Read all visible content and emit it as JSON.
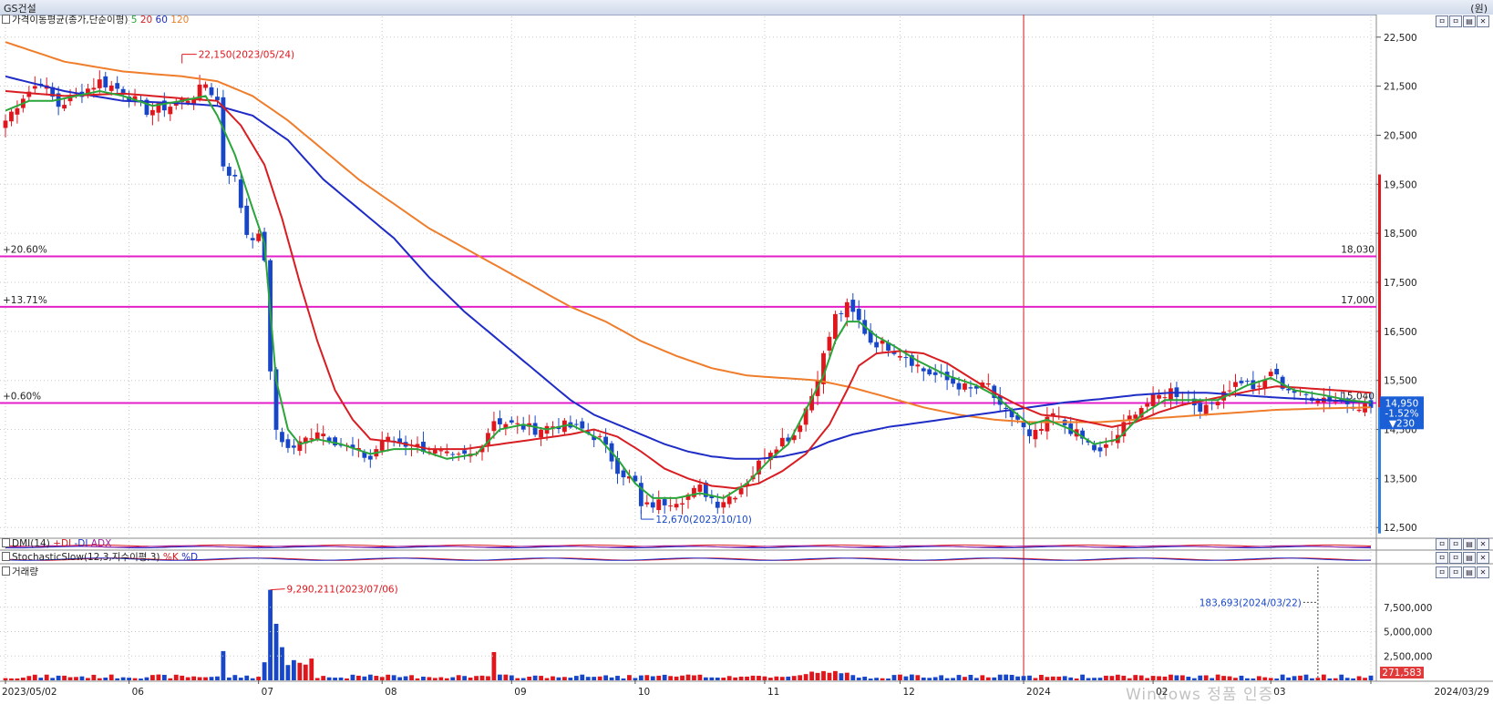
{
  "title": "GS건설",
  "unit": "(원)",
  "ma_legend": {
    "prefix": "가격이동평균(종가,단순이평)",
    "p5": "5",
    "p20": "20",
    "p60": "60",
    "p120": "120"
  },
  "colors": {
    "up": "#e0161d",
    "down": "#1747c8",
    "ma5": "#2aa53a",
    "ma20": "#d81e22",
    "ma60": "#1f2cc6",
    "ma120": "#ef7d2b",
    "hline": "#e21fc8",
    "vline": "#d11a1a"
  },
  "annotations": {
    "high": "22,150(2023/05/24)",
    "low": "12,670(2023/10/10)",
    "vol_high": "9,290,211(2023/07/06)",
    "vol_last": "183,693(2024/03/22)"
  },
  "hlines": [
    {
      "pct": "+20.60%",
      "price": "18,030",
      "value": 18030
    },
    {
      "pct": "+13.71%",
      "price": "17,000",
      "value": 17000
    },
    {
      "pct": "+0.60%",
      "price": "15,040",
      "value": 15040
    }
  ],
  "last_box": {
    "price": "14,950",
    "change_pct": "-1.52%",
    "change": "▼230"
  },
  "vol_last_box": "271,583",
  "panels": {
    "dmi": {
      "label": "DMI(14)",
      "s1": "+DI",
      "s2": "-DI",
      "s3": "ADX"
    },
    "stoch": {
      "label": "StochasticSlow(12,3,지수이평,3)",
      "s1": "%K",
      "s2": "%D"
    },
    "volume": {
      "label": "거래량"
    }
  },
  "window_controls": [
    "ㅁ",
    "ㅁ",
    "▤",
    "✕"
  ],
  "watermark": "Windows 정품 인증",
  "chart_data": {
    "type": "candlestick",
    "title": "GS건설",
    "y_range": [
      12300,
      22700
    ],
    "y_ticks": [
      12500,
      13500,
      14500,
      15500,
      16500,
      17500,
      18500,
      19500,
      20500,
      21500,
      22500
    ],
    "y_tick_labels": [
      "12,500",
      "13,500",
      "14,500",
      "15,500",
      "16,500",
      "17,500",
      "18,500",
      "19,500",
      "20,500",
      "21,500",
      "22,500"
    ],
    "x_ticks": [
      "2023/05/02",
      "06",
      "07",
      "08",
      "09",
      "10",
      "11",
      "12",
      "2024",
      "02",
      "03",
      "2024/03/29"
    ],
    "x_tick_index": [
      0,
      21,
      43,
      64,
      86,
      107,
      129,
      152,
      173,
      195,
      215,
      232
    ],
    "close_path": [
      [
        0,
        20800
      ],
      [
        3,
        21300
      ],
      [
        6,
        21600
      ],
      [
        9,
        21100
      ],
      [
        12,
        21300
      ],
      [
        16,
        21600
      ],
      [
        20,
        21400
      ],
      [
        24,
        21000
      ],
      [
        28,
        21100
      ],
      [
        32,
        21300
      ],
      [
        34,
        21550
      ],
      [
        36,
        21200
      ],
      [
        37,
        19900
      ],
      [
        39,
        19600
      ],
      [
        41,
        18500
      ],
      [
        43,
        18400
      ],
      [
        44,
        18000
      ],
      [
        45,
        15600
      ],
      [
        46,
        14500
      ],
      [
        48,
        14100
      ],
      [
        50,
        14200
      ],
      [
        53,
        14500
      ],
      [
        57,
        14200
      ],
      [
        62,
        13900
      ],
      [
        64,
        14300
      ],
      [
        68,
        14200
      ],
      [
        72,
        14100
      ],
      [
        76,
        13900
      ],
      [
        80,
        14000
      ],
      [
        83,
        14700
      ],
      [
        86,
        14600
      ],
      [
        90,
        14500
      ],
      [
        94,
        14600
      ],
      [
        98,
        14500
      ],
      [
        101,
        14300
      ],
      [
        104,
        13700
      ],
      [
        107,
        13400
      ],
      [
        108,
        12900
      ],
      [
        111,
        13000
      ],
      [
        115,
        13100
      ],
      [
        118,
        13300
      ],
      [
        121,
        13000
      ],
      [
        124,
        13200
      ],
      [
        127,
        13600
      ],
      [
        129,
        14000
      ],
      [
        132,
        14300
      ],
      [
        134,
        14400
      ],
      [
        137,
        15200
      ],
      [
        139,
        16000
      ],
      [
        141,
        16800
      ],
      [
        143,
        17000
      ],
      [
        145,
        16700
      ],
      [
        147,
        16300
      ],
      [
        150,
        16200
      ],
      [
        153,
        16000
      ],
      [
        156,
        15700
      ],
      [
        160,
        15500
      ],
      [
        164,
        15300
      ],
      [
        167,
        15400
      ],
      [
        169,
        14900
      ],
      [
        172,
        14700
      ],
      [
        174,
        14300
      ],
      [
        176,
        14500
      ],
      [
        178,
        14800
      ],
      [
        180,
        14600
      ],
      [
        183,
        14300
      ],
      [
        186,
        14000
      ],
      [
        189,
        14400
      ],
      [
        192,
        14900
      ],
      [
        195,
        15100
      ],
      [
        198,
        15300
      ],
      [
        201,
        15100
      ],
      [
        204,
        14900
      ],
      [
        207,
        15300
      ],
      [
        210,
        15500
      ],
      [
        213,
        15300
      ],
      [
        215,
        15700
      ],
      [
        217,
        15400
      ],
      [
        220,
        15200
      ],
      [
        224,
        15150
      ],
      [
        228,
        15050
      ],
      [
        232,
        14950
      ]
    ],
    "ma_path": {
      "ma5": [
        [
          0,
          21000
        ],
        [
          4,
          21200
        ],
        [
          8,
          21200
        ],
        [
          12,
          21300
        ],
        [
          16,
          21400
        ],
        [
          20,
          21300
        ],
        [
          25,
          21100
        ],
        [
          30,
          21200
        ],
        [
          34,
          21300
        ],
        [
          36,
          20900
        ],
        [
          39,
          20100
        ],
        [
          42,
          19000
        ],
        [
          44,
          18300
        ],
        [
          46,
          15500
        ],
        [
          48,
          14500
        ],
        [
          50,
          14200
        ],
        [
          53,
          14300
        ],
        [
          57,
          14200
        ],
        [
          62,
          14000
        ],
        [
          66,
          14100
        ],
        [
          70,
          14100
        ],
        [
          75,
          13900
        ],
        [
          80,
          14000
        ],
        [
          84,
          14500
        ],
        [
          88,
          14600
        ],
        [
          92,
          14500
        ],
        [
          96,
          14600
        ],
        [
          101,
          14300
        ],
        [
          104,
          13900
        ],
        [
          107,
          13400
        ],
        [
          110,
          13100
        ],
        [
          114,
          13100
        ],
        [
          118,
          13200
        ],
        [
          122,
          13100
        ],
        [
          126,
          13400
        ],
        [
          130,
          13900
        ],
        [
          133,
          14200
        ],
        [
          136,
          14900
        ],
        [
          139,
          15600
        ],
        [
          141,
          16300
        ],
        [
          143,
          16700
        ],
        [
          145,
          16700
        ],
        [
          148,
          16400
        ],
        [
          151,
          16200
        ],
        [
          155,
          15900
        ],
        [
          160,
          15600
        ],
        [
          165,
          15400
        ],
        [
          168,
          15200
        ],
        [
          171,
          14900
        ],
        [
          174,
          14600
        ],
        [
          177,
          14700
        ],
        [
          181,
          14500
        ],
        [
          185,
          14200
        ],
        [
          189,
          14300
        ],
        [
          193,
          14800
        ],
        [
          197,
          15100
        ],
        [
          201,
          15100
        ],
        [
          206,
          15100
        ],
        [
          211,
          15400
        ],
        [
          215,
          15550
        ],
        [
          219,
          15300
        ],
        [
          224,
          15200
        ],
        [
          228,
          15100
        ],
        [
          232,
          15050
        ]
      ],
      "ma20": [
        [
          0,
          21400
        ],
        [
          10,
          21300
        ],
        [
          20,
          21350
        ],
        [
          30,
          21250
        ],
        [
          36,
          21200
        ],
        [
          40,
          20700
        ],
        [
          44,
          19900
        ],
        [
          47,
          18800
        ],
        [
          50,
          17500
        ],
        [
          53,
          16300
        ],
        [
          56,
          15300
        ],
        [
          59,
          14700
        ],
        [
          62,
          14300
        ],
        [
          66,
          14250
        ],
        [
          72,
          14100
        ],
        [
          78,
          14100
        ],
        [
          84,
          14200
        ],
        [
          90,
          14300
        ],
        [
          96,
          14400
        ],
        [
          100,
          14500
        ],
        [
          104,
          14350
        ],
        [
          108,
          14050
        ],
        [
          112,
          13700
        ],
        [
          116,
          13500
        ],
        [
          120,
          13350
        ],
        [
          124,
          13300
        ],
        [
          128,
          13400
        ],
        [
          132,
          13650
        ],
        [
          136,
          14000
        ],
        [
          140,
          14600
        ],
        [
          143,
          15300
        ],
        [
          145,
          15800
        ],
        [
          148,
          16050
        ],
        [
          152,
          16100
        ],
        [
          156,
          16050
        ],
        [
          160,
          15850
        ],
        [
          164,
          15550
        ],
        [
          168,
          15250
        ],
        [
          172,
          15000
        ],
        [
          176,
          14800
        ],
        [
          180,
          14750
        ],
        [
          184,
          14650
        ],
        [
          188,
          14550
        ],
        [
          192,
          14650
        ],
        [
          196,
          14850
        ],
        [
          200,
          15000
        ],
        [
          204,
          15100
        ],
        [
          208,
          15200
        ],
        [
          212,
          15300
        ],
        [
          216,
          15380
        ],
        [
          220,
          15350
        ],
        [
          226,
          15300
        ],
        [
          232,
          15250
        ]
      ],
      "ma60": [
        [
          0,
          21700
        ],
        [
          10,
          21400
        ],
        [
          20,
          21200
        ],
        [
          30,
          21150
        ],
        [
          36,
          21100
        ],
        [
          42,
          20900
        ],
        [
          48,
          20400
        ],
        [
          54,
          19600
        ],
        [
          60,
          19000
        ],
        [
          66,
          18400
        ],
        [
          72,
          17600
        ],
        [
          78,
          16900
        ],
        [
          84,
          16300
        ],
        [
          90,
          15700
        ],
        [
          96,
          15100
        ],
        [
          100,
          14800
        ],
        [
          104,
          14600
        ],
        [
          108,
          14400
        ],
        [
          112,
          14200
        ],
        [
          116,
          14050
        ],
        [
          120,
          13950
        ],
        [
          124,
          13900
        ],
        [
          128,
          13900
        ],
        [
          132,
          13950
        ],
        [
          136,
          14050
        ],
        [
          140,
          14250
        ],
        [
          144,
          14400
        ],
        [
          150,
          14550
        ],
        [
          156,
          14650
        ],
        [
          162,
          14750
        ],
        [
          168,
          14850
        ],
        [
          174,
          14950
        ],
        [
          180,
          15050
        ],
        [
          186,
          15120
        ],
        [
          192,
          15200
        ],
        [
          198,
          15250
        ],
        [
          204,
          15250
        ],
        [
          210,
          15200
        ],
        [
          216,
          15150
        ],
        [
          224,
          15100
        ],
        [
          232,
          15050
        ]
      ],
      "ma120": [
        [
          0,
          22400
        ],
        [
          10,
          22000
        ],
        [
          20,
          21800
        ],
        [
          30,
          21700
        ],
        [
          36,
          21600
        ],
        [
          42,
          21300
        ],
        [
          48,
          20800
        ],
        [
          54,
          20200
        ],
        [
          60,
          19600
        ],
        [
          66,
          19100
        ],
        [
          72,
          18600
        ],
        [
          78,
          18200
        ],
        [
          84,
          17800
        ],
        [
          90,
          17400
        ],
        [
          96,
          17000
        ],
        [
          102,
          16700
        ],
        [
          108,
          16300
        ],
        [
          114,
          16000
        ],
        [
          120,
          15750
        ],
        [
          126,
          15600
        ],
        [
          132,
          15550
        ],
        [
          138,
          15500
        ],
        [
          144,
          15350
        ],
        [
          150,
          15150
        ],
        [
          156,
          14950
        ],
        [
          162,
          14800
        ],
        [
          168,
          14700
        ],
        [
          174,
          14650
        ],
        [
          180,
          14650
        ],
        [
          186,
          14650
        ],
        [
          192,
          14700
        ],
        [
          198,
          14750
        ],
        [
          204,
          14800
        ],
        [
          210,
          14850
        ],
        [
          216,
          14900
        ],
        [
          224,
          14930
        ],
        [
          232,
          14950
        ]
      ]
    },
    "volume_range": [
      0,
      10000000
    ],
    "volume_ticks": [
      "2,500,000",
      "5,000,000",
      "7,500,000"
    ],
    "volume_peak": [
      45,
      9290211
    ],
    "vline_index": 173
  }
}
